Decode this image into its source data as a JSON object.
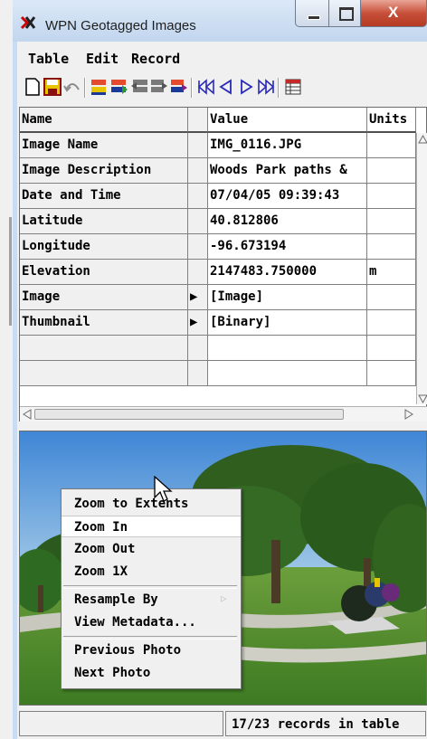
{
  "window": {
    "title": "WPN Geotagged Images",
    "caption_buttons": {
      "minimize": "–",
      "maximize": "□",
      "close": "X"
    }
  },
  "menubar": {
    "items": [
      "Table",
      "Edit",
      "Record"
    ]
  },
  "toolbar": {
    "buttons": [
      "new-icon",
      "save-icon",
      "undo-icon",
      "insert-record-icon",
      "copy-record-icon",
      "delete-record-icon",
      "append-record-icon",
      "edit-record-icon",
      "first-record-icon",
      "previous-record-icon",
      "next-record-icon",
      "last-record-icon",
      "tabular-view-icon"
    ]
  },
  "table": {
    "headers": [
      "Name",
      "",
      "Value",
      "Units"
    ],
    "rows": [
      {
        "name": "Image Name",
        "marker": "",
        "value": "IMG_0116.JPG",
        "units": ""
      },
      {
        "name": "Image Description",
        "marker": "",
        "value": "Woods Park paths &",
        "units": ""
      },
      {
        "name": "Date and Time",
        "marker": "",
        "value": "07/04/05 09:39:43",
        "units": ""
      },
      {
        "name": "Latitude",
        "marker": "",
        "value": "40.812806",
        "units": ""
      },
      {
        "name": "Longitude",
        "marker": "",
        "value": "-96.673194",
        "units": ""
      },
      {
        "name": "Elevation",
        "marker": "",
        "value": "2147483.750000",
        "units": "m"
      },
      {
        "name": "Image",
        "marker": "▶",
        "value": "[Image]",
        "units": ""
      },
      {
        "name": "Thumbnail",
        "marker": "▶",
        "value": "[Binary]",
        "units": ""
      },
      {
        "name": "",
        "marker": "",
        "value": "",
        "units": ""
      },
      {
        "name": "",
        "marker": "",
        "value": "",
        "units": ""
      }
    ]
  },
  "context_menu": {
    "items": [
      "Zoom to Extents",
      "Zoom In",
      "Zoom Out",
      "Zoom 1X",
      "Resample By",
      "View Metadata...",
      "Previous Photo",
      "Next Photo"
    ],
    "highlighted": "Zoom In",
    "submenu_indicator": "▷"
  },
  "status": {
    "left": "",
    "records": "17/23 records in table"
  },
  "colors": {
    "frame": "#c9dcf1",
    "face": "#f0f0f0",
    "close_button": "#c7503a",
    "sky": "#5a9be0",
    "grass": "#4f8a2e"
  }
}
